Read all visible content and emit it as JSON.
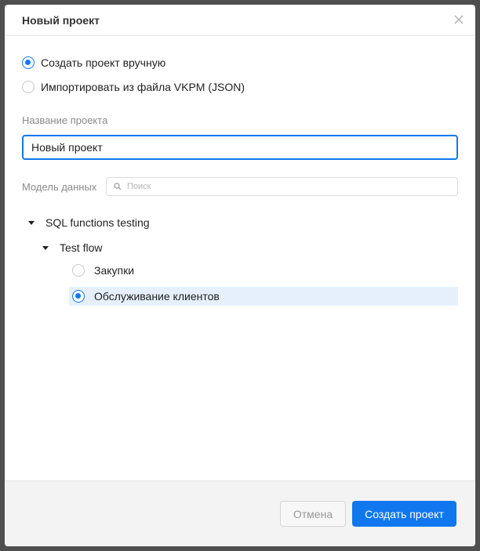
{
  "dialog": {
    "title": "Новый проект"
  },
  "mode_options": [
    {
      "label": "Создать проект вручную",
      "checked": true
    },
    {
      "label": "Импортировать из файла VKPM (JSON)",
      "checked": false
    }
  ],
  "project_name": {
    "label": "Название проекта",
    "value": "Новый проект"
  },
  "data_model": {
    "label": "Модель данных",
    "search_placeholder": "Поиск",
    "tree": {
      "root": {
        "label": "SQL functions testing",
        "expanded": true
      },
      "child": {
        "label": "Test flow",
        "expanded": true
      },
      "leaves": [
        {
          "label": "Закупки",
          "selected": false
        },
        {
          "label": "Обслуживание клиентов",
          "selected": true
        }
      ]
    }
  },
  "footer": {
    "cancel_label": "Отмена",
    "create_label": "Создать проект"
  },
  "colors": {
    "accent": "#1177ee",
    "selected_row": "#e5f0fc"
  }
}
